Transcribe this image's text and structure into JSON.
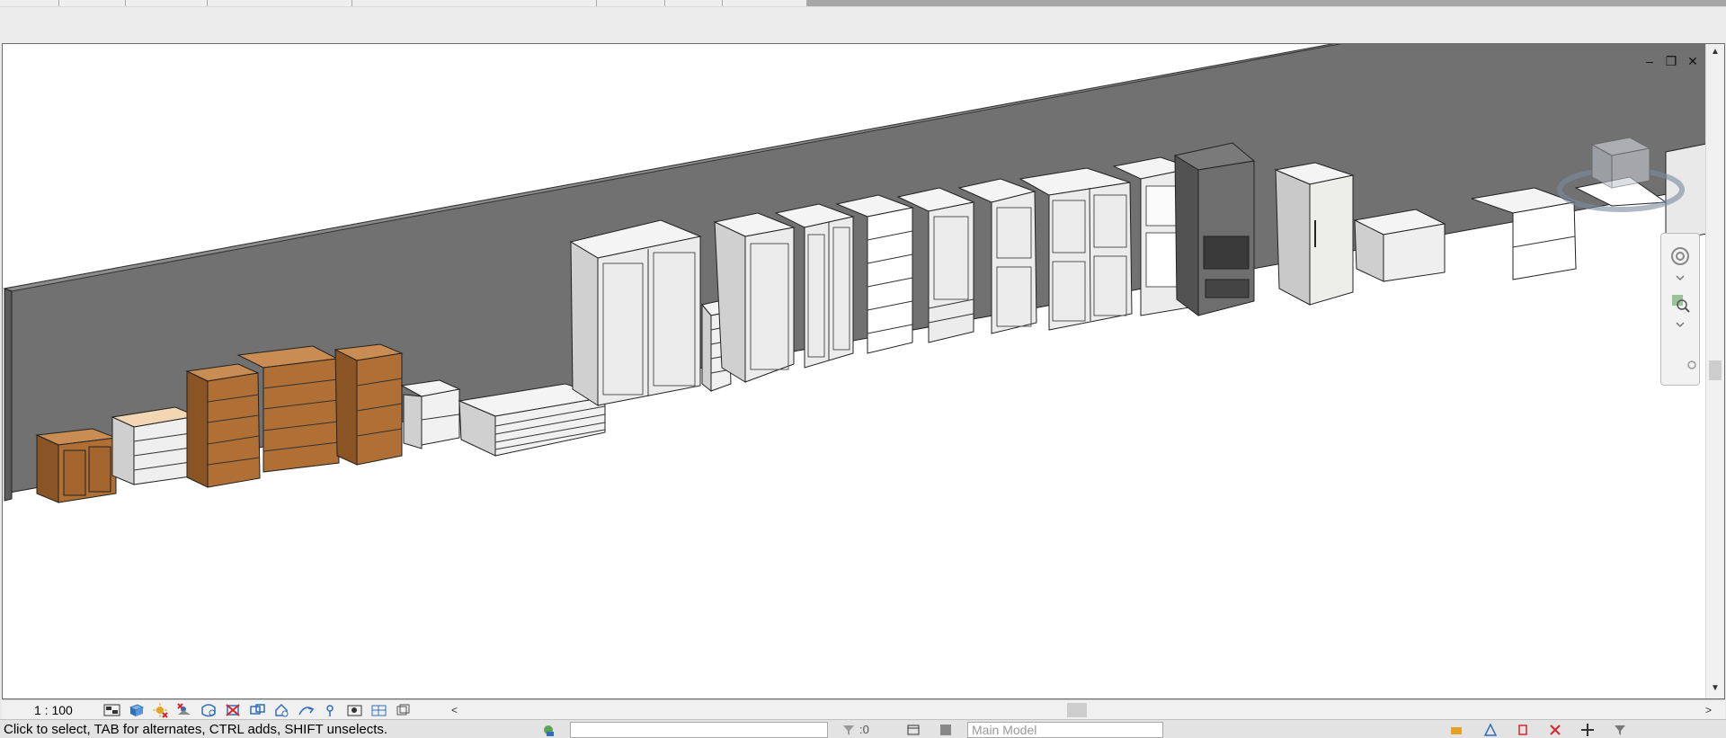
{
  "viewport": {
    "window_controls": {
      "minimize": "–",
      "restore": "❐",
      "close": "✕"
    },
    "navbar": {
      "icons": [
        "steering-wheel-icon",
        "zoom-icon",
        "customize-icon"
      ]
    },
    "scroll": {
      "up": "▲",
      "down": "▼",
      "left": "<",
      "right": ">"
    }
  },
  "view_control_bar": {
    "scale": "1 : 100",
    "icons": [
      "detail-level-icon",
      "visual-style-icon",
      "sun-path-icon",
      "shadows-icon",
      "render-icon",
      "crop-view-icon",
      "show-crop-icon",
      "temporary-hide-icon",
      "reveal-hidden-icon",
      "lock-3d-view-icon",
      "highlight-displacement-icon",
      "worksharing-icon",
      "analytical-model-icon"
    ],
    "collapse_arrow": "<"
  },
  "status_bar": {
    "message": "Click to select, TAB for alternates, CTRL adds, SHIFT unselects.",
    "filter_count": ":0",
    "model_field": "Main Model"
  },
  "colors": {
    "wall": "#717171",
    "wall_top": "#8c8c8c",
    "wood": "#b06f35",
    "white_cabinet": "#f1f1f1",
    "accent_blue": "#2f6fb7",
    "accent_red": "#d7262b",
    "accent_orange": "#e3a221"
  }
}
